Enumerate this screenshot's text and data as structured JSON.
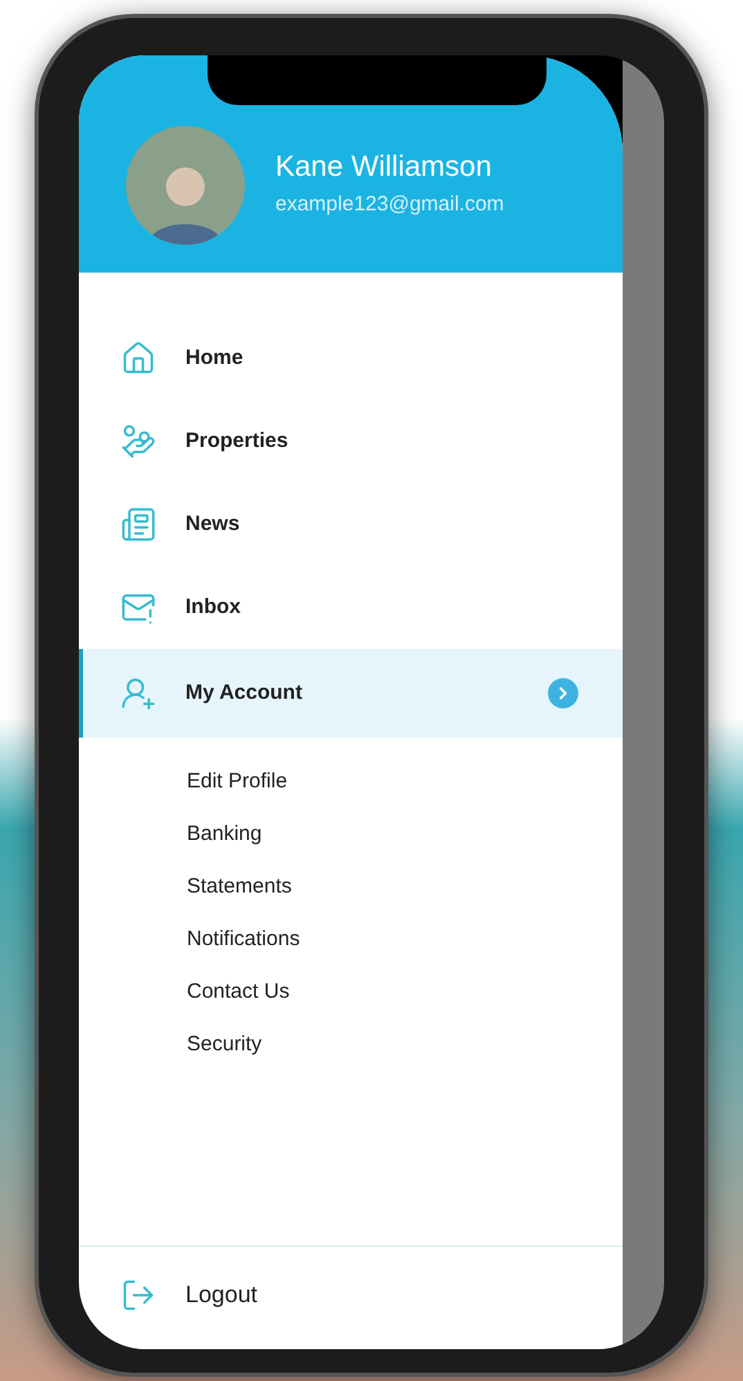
{
  "profile": {
    "name": "Kane Williamson",
    "email": "example123@gmail.com"
  },
  "menu": [
    {
      "label": "Home",
      "selected": false
    },
    {
      "label": "Properties",
      "selected": false
    },
    {
      "label": "News",
      "selected": false
    },
    {
      "label": "Inbox",
      "selected": false
    },
    {
      "label": "My Account",
      "selected": true,
      "expanded": true,
      "children": [
        {
          "label": "Edit Profile"
        },
        {
          "label": "Banking"
        },
        {
          "label": "Statements"
        },
        {
          "label": "Notifications"
        },
        {
          "label": "Contact Us"
        },
        {
          "label": "Security"
        }
      ]
    }
  ],
  "logout": {
    "label": "Logout"
  }
}
